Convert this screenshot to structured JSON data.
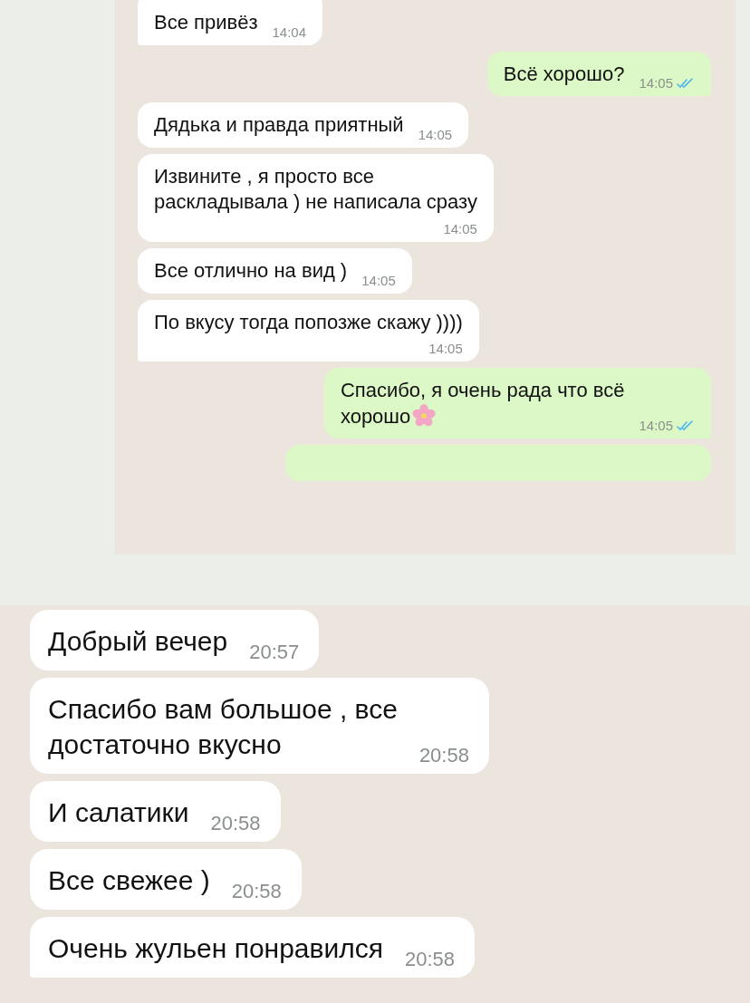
{
  "screenshots": [
    {
      "large_text": false,
      "messages": [
        {
          "outgoing": false,
          "text": "Все привёз",
          "time": "14:04",
          "time_below": false,
          "tail": true
        },
        {
          "outgoing": true,
          "text": "Всё хорошо?",
          "time": "14:05",
          "time_below": false,
          "tail": true,
          "read": true
        },
        {
          "outgoing": false,
          "text": "Дядька и правда приятный",
          "time": "14:05",
          "time_below": false,
          "tail": false
        },
        {
          "outgoing": false,
          "text": "Извините , я просто все\nраскладывала ) не написала сразу",
          "time": "14:05",
          "time_below": true,
          "tail": false
        },
        {
          "outgoing": false,
          "text": "Все отлично на вид )",
          "time": "14:05",
          "time_below": false,
          "tail": false
        },
        {
          "outgoing": false,
          "text": "По вкусу тогда попозже скажу ))))",
          "time": "14:05",
          "time_below": true,
          "tail": true
        },
        {
          "outgoing": true,
          "text": "Спасибо, я очень рада что всё\nхорошо",
          "flower": true,
          "time": "14:05",
          "time_below": false,
          "tail": true,
          "read": true
        },
        {
          "outgoing": true,
          "cut": true
        }
      ]
    },
    {
      "large_text": true,
      "messages": [
        {
          "outgoing": false,
          "text": "Добрый вечер",
          "time": "20:57",
          "time_below": false,
          "tail": false
        },
        {
          "outgoing": false,
          "text": "Спасибо вам большое , все\nдостаточно вкусно",
          "time": "20:58",
          "time_below": false,
          "tail": false
        },
        {
          "outgoing": false,
          "text": "И салатики",
          "time": "20:58",
          "time_below": false,
          "tail": false
        },
        {
          "outgoing": false,
          "text": "Все свежее )",
          "time": "20:58",
          "time_below": false,
          "tail": false
        },
        {
          "outgoing": false,
          "text": "Очень жульен понравился",
          "time": "20:58",
          "time_below": false,
          "tail": true
        }
      ]
    }
  ]
}
